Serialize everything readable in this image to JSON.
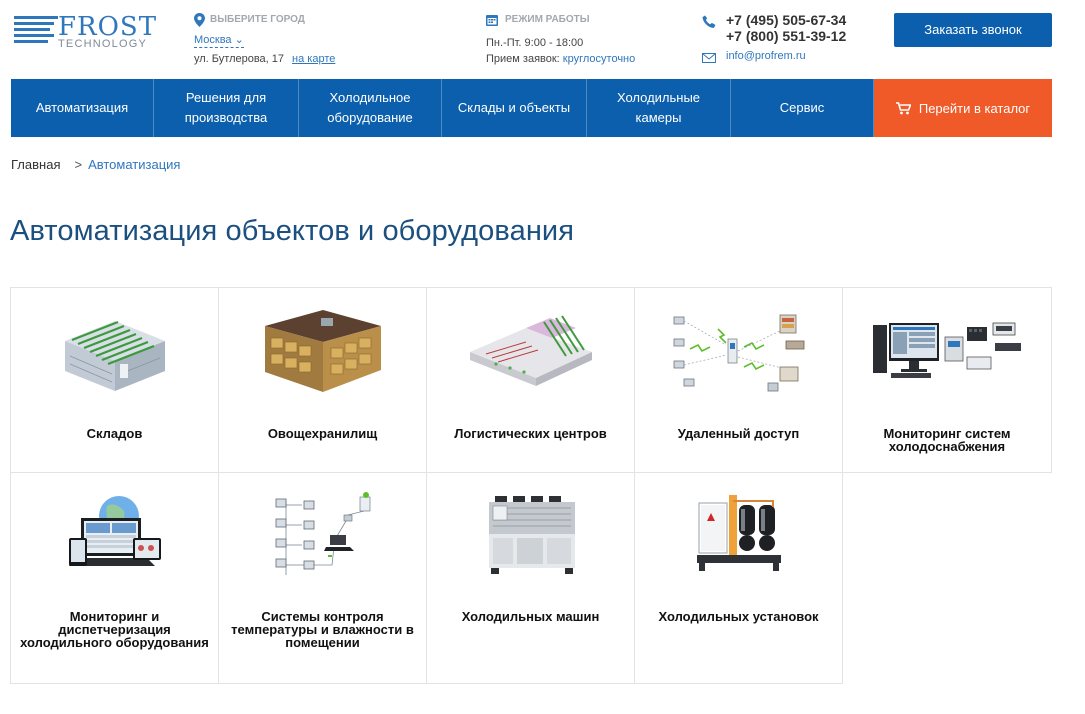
{
  "header": {
    "logo": {
      "brand": "FROST",
      "sub": "TECHNOLOGY"
    },
    "city": {
      "caption": "ВЫБЕРИТЕ ГОРОД",
      "value": "Москва",
      "address": "ул. Бутлерова, 17",
      "map_link": "на карте"
    },
    "hours": {
      "caption": "РЕЖИМ РАБОТЫ",
      "weekdays": "Пн.-Пт. 9:00 - 18:00",
      "orders_label": "Прием заявок:",
      "orders_value": "круглосуточно"
    },
    "contacts": {
      "phone1": "+7 (495) 505-67-34",
      "phone2": "+7 (800) 551-39-12",
      "email": "info@profrem.ru"
    },
    "callback_button": "Заказать звонок"
  },
  "nav": {
    "items": [
      "Автоматизация",
      "Решения для производства",
      "Холодильное оборудование",
      "Склады и объекты",
      "Холодильные камеры",
      "Сервис"
    ],
    "catalog": "Перейти в каталог"
  },
  "breadcrumb": {
    "home": "Главная",
    "sep": ">",
    "current": "Автоматизация"
  },
  "page_title": "Автоматизация объектов и оборудования",
  "cards": [
    {
      "label": "Складов",
      "icon": "warehouse-racks-image"
    },
    {
      "label": "Овощехранилищ",
      "icon": "vegetable-storage-image"
    },
    {
      "label": "Логистических центров",
      "icon": "logistics-center-image"
    },
    {
      "label": "Удаленный доступ",
      "icon": "remote-access-network-image"
    },
    {
      "label": "Мониторинг систем холодоснабжения",
      "icon": "monitoring-computer-image"
    },
    {
      "label": "Мониторинг и диспетчеризация холодильного оборудования",
      "icon": "devices-globe-image"
    },
    {
      "label": "Системы контроля температуры и влажности в помещении",
      "icon": "sensor-network-image"
    },
    {
      "label": "Холодильных машин",
      "icon": "chiller-image"
    },
    {
      "label": "Холодильных установок",
      "icon": "refrigeration-unit-image"
    }
  ],
  "colors": {
    "primary": "#0b5fad",
    "accent": "#f05a28",
    "title": "#1b4f80",
    "link": "#2f77bd"
  }
}
